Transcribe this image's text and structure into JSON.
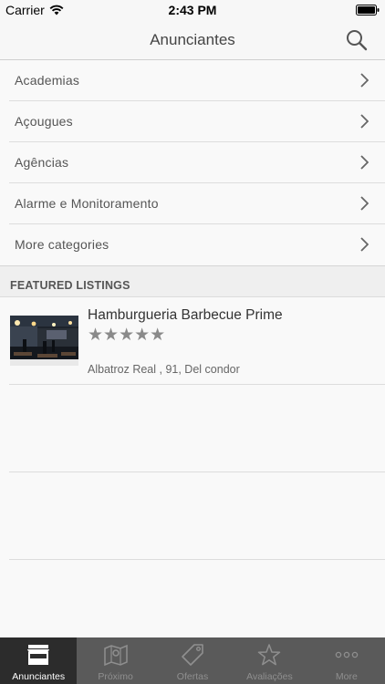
{
  "status_bar": {
    "carrier": "Carrier",
    "time": "2:43 PM"
  },
  "nav": {
    "title": "Anunciantes",
    "search_icon": "search-icon"
  },
  "categories": [
    {
      "label": "Academias"
    },
    {
      "label": "Açougues"
    },
    {
      "label": "Agências"
    },
    {
      "label": "Alarme e Monitoramento"
    },
    {
      "label": "More categories"
    }
  ],
  "featured": {
    "header": "FEATURED LISTINGS",
    "listings": [
      {
        "name": "Hamburgueria Barbecue Prime",
        "stars": "★★★★★",
        "rating": 0,
        "address": "Albatroz Real , 91, Del condor"
      }
    ]
  },
  "tabs": [
    {
      "label": "Anunciantes",
      "icon": "storefront-icon",
      "active": true
    },
    {
      "label": "Próximo",
      "icon": "map-icon",
      "active": false
    },
    {
      "label": "Ofertas",
      "icon": "tag-icon",
      "active": false
    },
    {
      "label": "Avaliações",
      "icon": "star-icon",
      "active": false
    },
    {
      "label": "More",
      "icon": "more-dots-icon",
      "active": false
    }
  ],
  "colors": {
    "tab_bar": "#5a5a5a",
    "tab_active": "#2c2c2c",
    "nav_bg": "#f7f7f7"
  }
}
